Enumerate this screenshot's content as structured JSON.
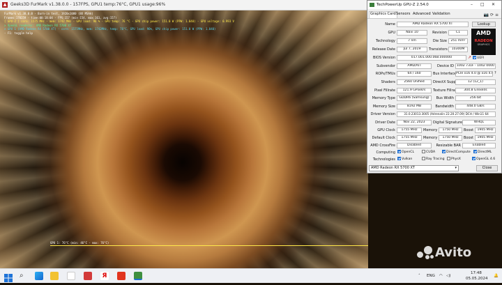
{
  "furmark": {
    "title": "Geeks3D FurMark v1.38.0.0 - 157FPS, GPU1 temp:76°C, GPU1 usage:96%",
    "osd": [
      {
        "text": "FurMark v1.38.0.0 - Burn-in test, 1920x1080 (8X MSAA)",
        "color": "white"
      },
      {
        "text": "Frames:170259 - time:00:18:04 - FPS:157 (min:154, max:161, avg:157)",
        "color": "white"
      },
      {
        "text": "[ GPU-Z ] core: 1575 MHz - mem: 1742 MHz - GPU load: 96 % - GPU temp: 76 °C - GPU chip power: 151.0 W (PPW: 1.040) - GPU voltage: 0.993 V",
        "color": "yellow"
      },
      {
        "text": "> OpenGL renderer: AMD Radeon RX 5700 XT",
        "color": "green"
      },
      {
        "text": "> GPU 1 (AMD Radeon RX 5700 XT) - core: 1575MHz, mem: 1742MHz, temp: 76°C, GPU load: 96%, GPU chip power: 151.0 W (PPW: 1.040)",
        "color": "cyan"
      },
      {
        "text": "- F1: toggle help",
        "color": "white"
      }
    ],
    "graph_label": "GPU 1: 76°C (min: 46°C - max: 76°C)"
  },
  "gpuz": {
    "title": "TechPowerUp GPU-Z 2.54.0",
    "tabs": [
      "Graphics Card",
      "Sensors",
      "Advanced",
      "Validation"
    ],
    "active_tab": "Graphics Card",
    "lookup_label": "Lookup",
    "uefi_label": "UEFI",
    "fields": {
      "name": {
        "label": "Name",
        "value": "AMD Radeon RX 5700 XT"
      },
      "gpu": {
        "label": "GPU",
        "value": "Navi 10"
      },
      "revision": {
        "label": "Revision",
        "value": "C1"
      },
      "technology": {
        "label": "Technology",
        "value": "7 nm"
      },
      "die_size": {
        "label": "Die Size",
        "value": "251 mm²"
      },
      "release_date": {
        "label": "Release Date",
        "value": "Jul 7, 2019"
      },
      "transistors": {
        "label": "Transistors",
        "value": "10300M"
      },
      "bios": {
        "label": "BIOS Version",
        "value": "017.001.000.068.000000"
      },
      "subvendor": {
        "label": "Subvendor",
        "value": "AMD/ATI"
      },
      "device_id": {
        "label": "Device ID",
        "value": "1002 731F - 1002 0000"
      },
      "rops": {
        "label": "ROPs/TMUs",
        "value": "64 / 160"
      },
      "bus_interface": {
        "label": "Bus Interface",
        "value": "PCIe x16 4.0 @ x16 4.0"
      },
      "shaders": {
        "label": "Shaders",
        "value": "2560 Unified"
      },
      "directx": {
        "label": "DirectX Support",
        "value": "12 (12_1)"
      },
      "pixel_fillrate": {
        "label": "Pixel Fillrate",
        "value": "121.9 GPixel/s"
      },
      "texture_fillrate": {
        "label": "Texture Fillrate",
        "value": "304.8 GTexel/s"
      },
      "memory_type": {
        "label": "Memory Type",
        "value": "GDDR6 (Samsung)"
      },
      "bus_width": {
        "label": "Bus Width",
        "value": "256 bit"
      },
      "memory_size": {
        "label": "Memory Size",
        "value": "8192 MB"
      },
      "bandwidth": {
        "label": "Bandwidth",
        "value": "448.0 GB/s"
      },
      "driver_version": {
        "label": "Driver Version",
        "value": "31.0.23013.3005 (Adrenalin 22.20.27.09) DCH / Win11 64"
      },
      "driver_date": {
        "label": "Driver Date",
        "value": "Nov 22, 2023"
      },
      "digital_signature": {
        "label": "Digital Signature",
        "value": "WHQL"
      },
      "gpu_clock": {
        "label": "GPU Clock",
        "value": "1755 MHz"
      },
      "gpu_memory": {
        "label": "Memory",
        "value": "1750 MHz"
      },
      "gpu_boost": {
        "label": "Boost",
        "value": "1905 MHz"
      },
      "default_clock": {
        "label": "Default Clock",
        "value": "1755 MHz"
      },
      "default_memory": {
        "label": "Memory",
        "value": "1750 MHz"
      },
      "default_boost": {
        "label": "Boost",
        "value": "1905 MHz"
      },
      "crossfire": {
        "label": "AMD CrossFire",
        "value": "Disabled"
      },
      "resizable_bar": {
        "label": "Resizable BAR",
        "value": "Enabled"
      }
    },
    "computing_label": "Computing",
    "computing": [
      {
        "label": "OpenCL",
        "checked": true
      },
      {
        "label": "CUDA",
        "checked": false
      },
      {
        "label": "DirectCompute",
        "checked": true
      },
      {
        "label": "DirectML",
        "checked": true
      }
    ],
    "technologies_label": "Technologies",
    "technologies": [
      {
        "label": "Vulkan",
        "checked": true
      },
      {
        "label": "Ray Tracing",
        "checked": false
      },
      {
        "label": "PhysX",
        "checked": false
      },
      {
        "label": "OpenGL 4.6",
        "checked": true
      }
    ],
    "selected_gpu": "AMD Radeon RX 5700 XT",
    "close_label": "Close",
    "amd_logo": {
      "brand": "AMD",
      "product": "RADEON",
      "sub": "GRAPHICS"
    }
  },
  "taskbar": {
    "language": "ENG",
    "time": "17:48",
    "date": "05.05.2024"
  },
  "watermark": "Avito",
  "colors": {
    "osd_white": "#ffffff",
    "osd_yellow": "#ffe84a",
    "osd_green": "#5af0a0",
    "osd_cyan": "#55d6f0",
    "checkbox_on": "#1f6fd1",
    "amd_red": "#ee3333"
  }
}
